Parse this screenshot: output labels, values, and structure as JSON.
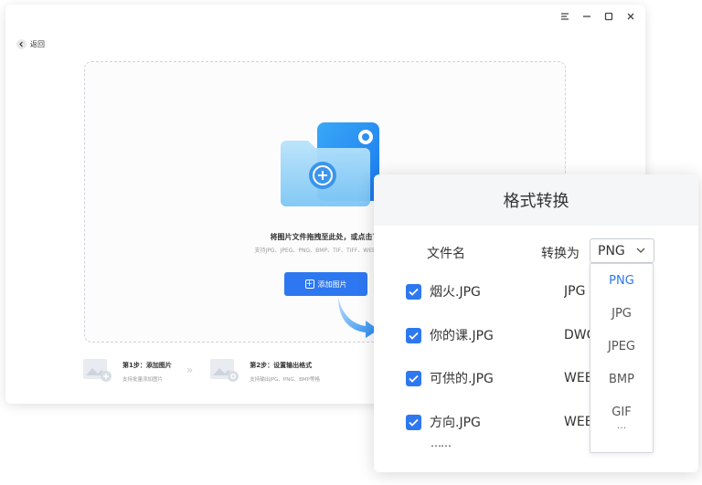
{
  "window": {
    "back_label": "返回",
    "controls": [
      "menu-icon",
      "minimize-icon",
      "maximize-icon",
      "close-icon"
    ]
  },
  "dropzone": {
    "title": "将图片文件拖拽至此处，或点击下",
    "subtitle": "支持JPG、JPEG、PNG、BMP、TIF、TIFF、WEBP、PDF",
    "add_button_label": "添加图片"
  },
  "steps": [
    {
      "title": "第1步：添加图片",
      "desc": "支持批量添加图片"
    },
    {
      "title": "第2步：设置输出格式",
      "desc": "支持输出JPG、PNG、BMP等格"
    }
  ],
  "dialog": {
    "title": "格式转换",
    "col_filename": "文件名",
    "col_convert": "转换为",
    "selected_format": "PNG",
    "files": [
      {
        "name": "烟火.JPG",
        "format": "JPG",
        "checked": true
      },
      {
        "name": "你的课.JPG",
        "format": "DWG",
        "checked": true
      },
      {
        "name": "可供的.JPG",
        "format": "WEBP",
        "checked": true
      },
      {
        "name": "方向.JPG",
        "format": "WEBP",
        "checked": true
      }
    ],
    "more": "……",
    "options": [
      "PNG",
      "JPG",
      "JPEG",
      "BMP",
      "GIF"
    ],
    "options_more": "..."
  },
  "colors": {
    "accent": "#2d78f0",
    "folder_light": "#8fd0f7",
    "folder_dark": "#1a8cf2"
  }
}
